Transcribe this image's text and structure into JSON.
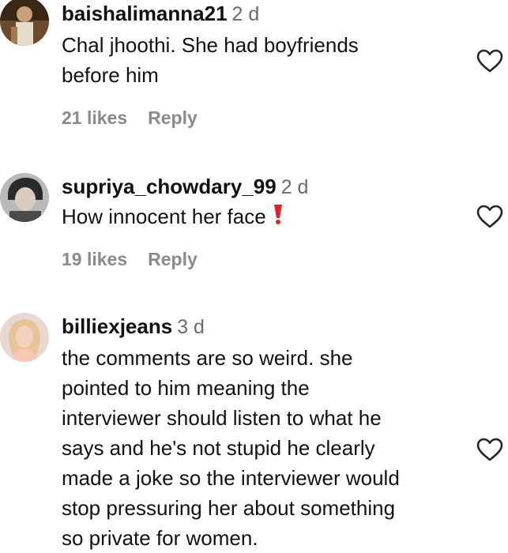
{
  "comments": [
    {
      "username": "baishalimanna21",
      "time": "2 d",
      "lines": [
        "Chal jhoothi. She had boyfriends",
        "before him"
      ],
      "likes": "21 likes",
      "reply": "Reply",
      "avatar_icon": "profile-photo"
    },
    {
      "username": "supriya_chowdary_99",
      "time": "2 d",
      "lines": [
        "How innocent her face"
      ],
      "emoji_icon": "red-exclamation-mark-icon",
      "likes": "19 likes",
      "reply": "Reply",
      "avatar_icon": "profile-photo"
    },
    {
      "username": "billiexjeans",
      "time": "3 d",
      "lines": [
        "the comments are so weird. she",
        "pointed to him meaning the",
        "interviewer should listen to what he",
        "says and he's not stupid he clearly",
        "made a joke so the interviewer would",
        "stop pressuring her about something",
        "so private for women."
      ],
      "avatar_icon": "profile-photo"
    }
  ],
  "icons": {
    "like": "heart-outline-icon"
  },
  "colors": {
    "text": "#111111",
    "muted": "#8a8a8a",
    "emoji": "#e0202e"
  }
}
